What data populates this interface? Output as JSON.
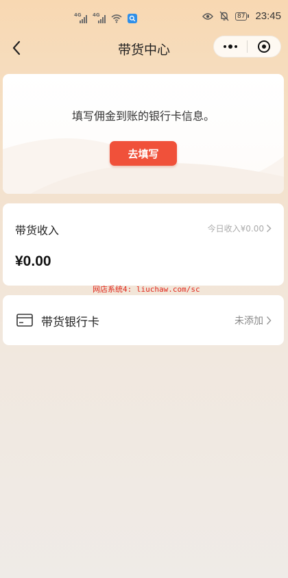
{
  "status_bar": {
    "sim1": "4G",
    "sim2": "4G",
    "battery": "87",
    "time": "23:45"
  },
  "nav": {
    "title": "带货中心"
  },
  "bank_info_card": {
    "text": "填写佣金到账的银行卡信息。",
    "button_label": "去填写",
    "accent": "#f0513a"
  },
  "income_card": {
    "title": "带货收入",
    "today_label": "今日收入¥0.00",
    "amount": "¥0.00"
  },
  "watermark": "网店系统4: liuchaw.com/sc",
  "bank_card_row": {
    "label": "带货银行卡",
    "status": "未添加"
  },
  "icons": [
    "back-arrow-icon",
    "more-dots-icon",
    "close-target-icon",
    "bank-card-icon",
    "chevron-right-icon",
    "wifi-icon",
    "eye-icon",
    "mute-bell-icon",
    "search-icon"
  ]
}
